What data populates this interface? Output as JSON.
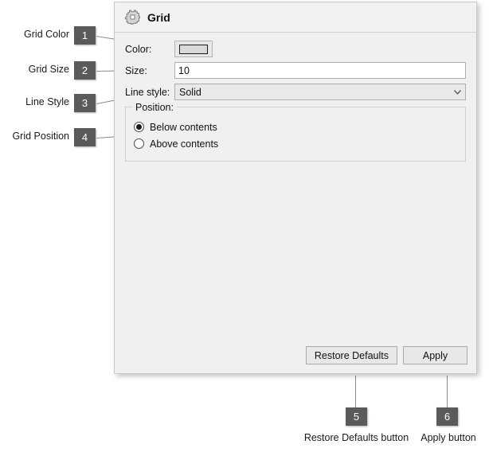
{
  "dialog": {
    "title": "Grid",
    "icon": "grid-icon",
    "fields": {
      "color": {
        "label": "Color:",
        "swatch_color": "#d9d9d9"
      },
      "size": {
        "label": "Size:",
        "value": "10",
        "placeholder": ""
      },
      "line_style": {
        "label": "Line style:",
        "value": "Solid",
        "arrow_icon": "chevron-down-icon"
      }
    },
    "position_group": {
      "title": "Position:",
      "options": [
        {
          "label": "Below contents",
          "selected": true
        },
        {
          "label": "Above contents",
          "selected": false
        }
      ]
    },
    "footer": {
      "restore_defaults_label": "Restore Defaults",
      "apply_label": "Apply"
    }
  },
  "annotations": [
    {
      "number": "1",
      "label": "Grid Color"
    },
    {
      "number": "2",
      "label": "Grid Size"
    },
    {
      "number": "3",
      "label": "Line Style"
    },
    {
      "number": "4",
      "label": "Grid Position"
    },
    {
      "number": "5",
      "label": "Restore Defaults button"
    },
    {
      "number": "6",
      "label": "Apply button"
    }
  ],
  "colors": {
    "badge": "#5a5a5a",
    "dialog_bg": "#f0f0f0",
    "header_bg": "#f2f2f2",
    "input_bg": "#ffffff"
  }
}
